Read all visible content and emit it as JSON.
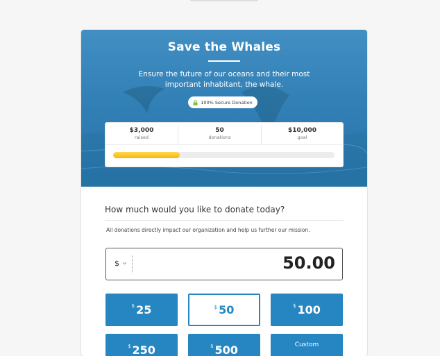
{
  "hero": {
    "title": "Save the Whales",
    "description": "Ensure the future of our oceans and their most important inhabitant, the whale.",
    "secure_label": "100% Secure Donation"
  },
  "stats": {
    "raised": {
      "value": "$3,000",
      "label": "raised"
    },
    "donations": {
      "value": "50",
      "label": "donations"
    },
    "goal": {
      "value": "$10,000",
      "label": "goal"
    },
    "progress_fraction": 0.3
  },
  "form": {
    "question": "How much would you like to donate today?",
    "note": "All donations directly impact our organization and help us further our mission.",
    "currency_symbol": "$",
    "amount": "50.00"
  },
  "presets": [
    {
      "currency": "$",
      "amount": "25",
      "selected": false
    },
    {
      "currency": "$",
      "amount": "50",
      "selected": true
    },
    {
      "currency": "$",
      "amount": "100",
      "selected": false
    },
    {
      "currency": "$",
      "amount": "250",
      "selected": false
    },
    {
      "currency": "$",
      "amount": "500",
      "selected": false
    }
  ],
  "custom_label": "Custom",
  "colors": {
    "accent": "#2586c2",
    "progress": "#f5bd1d"
  }
}
